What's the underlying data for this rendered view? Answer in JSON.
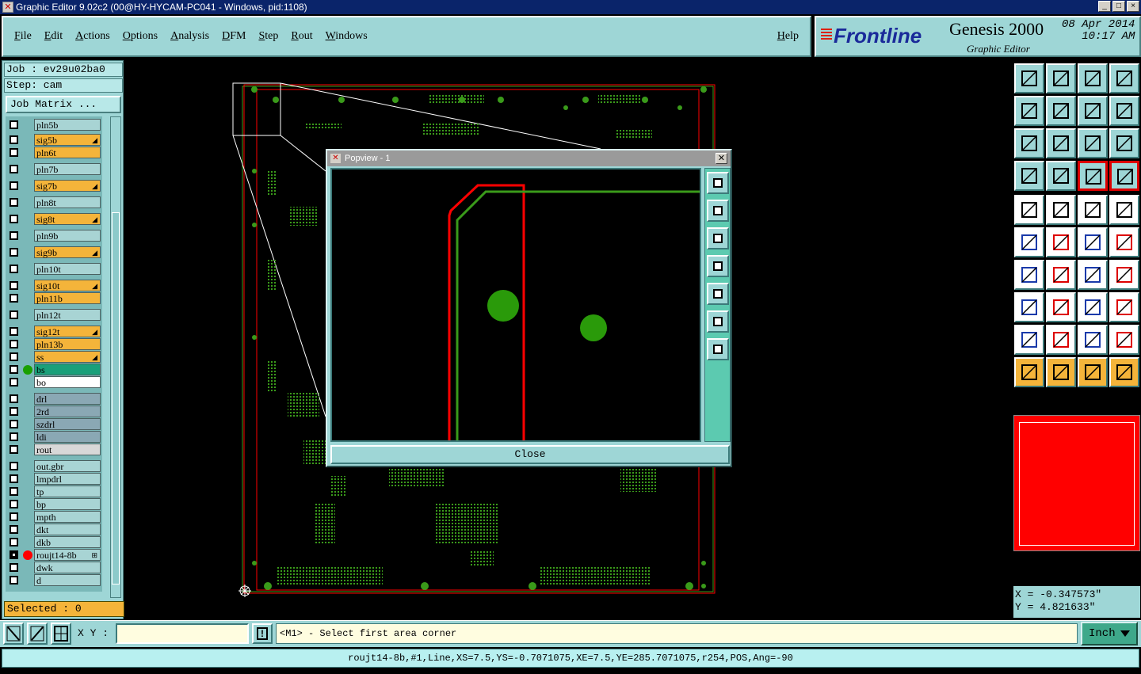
{
  "window": {
    "title": "Graphic Editor 9.02c2 (00@HY-HYCAM-PC041 - Windows, pid:1108)",
    "controls": [
      "_",
      "□",
      "×"
    ]
  },
  "menu": {
    "items": [
      "File",
      "Edit",
      "Actions",
      "Options",
      "Analysis",
      "DFM",
      "Step",
      "Rout",
      "Windows"
    ],
    "help": "Help"
  },
  "branding": {
    "logo": "Frontline",
    "product": "Genesis 2000",
    "subtitle": "Graphic Editor",
    "date": "08 Apr 2014",
    "time": "10:17 AM"
  },
  "job": {
    "job_label": "Job : ev29u02ba0",
    "step_label": "Step: cam",
    "matrix_button": "Job Matrix ..."
  },
  "layers": [
    {
      "name": "pln5b",
      "color": "#a8d4d4"
    },
    {
      "name": "sig5b",
      "color": "#f4b43a",
      "arrow": true
    },
    {
      "name": "pln6t",
      "color": "#f4b43a"
    },
    {
      "name": "pln7b",
      "color": "#a8d4d4"
    },
    {
      "name": "sig7b",
      "color": "#f4b43a",
      "arrow": true
    },
    {
      "name": "pln8t",
      "color": "#a8d4d4"
    },
    {
      "name": "sig8t",
      "color": "#f4b43a",
      "arrow": true
    },
    {
      "name": "pln9b",
      "color": "#a8d4d4"
    },
    {
      "name": "sig9b",
      "color": "#f4b43a",
      "arrow": true
    },
    {
      "name": "pln10t",
      "color": "#a8d4d4"
    },
    {
      "name": "sig10t",
      "color": "#f4b43a",
      "arrow": true
    },
    {
      "name": "pln11b",
      "color": "#f4b43a"
    },
    {
      "name": "pln12t",
      "color": "#a8d4d4"
    },
    {
      "name": "sig12t",
      "color": "#f4b43a",
      "arrow": true
    },
    {
      "name": "pln13b",
      "color": "#f4b43a"
    },
    {
      "name": "ss",
      "color": "#f4b43a",
      "arrow": true
    },
    {
      "name": "bs",
      "color": "#1aa07a",
      "dot": "#1aa000"
    },
    {
      "name": "bo",
      "color": "#ffffff"
    },
    {
      "name": "drl",
      "color": "#8aa8b4"
    },
    {
      "name": "2rd",
      "color": "#8aa8b4"
    },
    {
      "name": "szdrl",
      "color": "#8aa8b4"
    },
    {
      "name": "ldi",
      "color": "#8aa8b4"
    },
    {
      "name": "rout",
      "color": "#d8d8d8"
    },
    {
      "name": "out.gbr",
      "color": "#a8d4d4"
    },
    {
      "name": "lmpdrl",
      "color": "#a8d4d4"
    },
    {
      "name": "tp",
      "color": "#a8d4d4"
    },
    {
      "name": "bp",
      "color": "#a8d4d4"
    },
    {
      "name": "mpth",
      "color": "#a8d4d4"
    },
    {
      "name": "dkt",
      "color": "#a8d4d4"
    },
    {
      "name": "dkb",
      "color": "#a8d4d4"
    },
    {
      "name": "roujt14-8b",
      "color": "#a8d4d4",
      "dot": "#ff0000",
      "selected": true,
      "mark": "⊞"
    },
    {
      "name": "dwk",
      "color": "#a8d4d4"
    },
    {
      "name": "d",
      "color": "#a8d4d4"
    }
  ],
  "selected_count": "Selected : 0",
  "popview": {
    "title": "Popview - 1",
    "close_label": "Close"
  },
  "coordinates": {
    "x": "X = -0.347573\"",
    "y": "Y = 4.821633\""
  },
  "bottom": {
    "xy_label": "X Y :",
    "xy_value": "",
    "message": "<M1> - Select first area corner",
    "unit": "Inch"
  },
  "status": "roujt14-8b,#1,Line,XS=7.5,YS=-0.7071075,XE=7.5,YE=285.7071075,r254,POS,Ang=-90",
  "colors": {
    "panel": "#9ed6d6",
    "signal_layer": "#f4b43a",
    "trace_red": "#ff0000",
    "trace_green": "#3a9a1a"
  }
}
